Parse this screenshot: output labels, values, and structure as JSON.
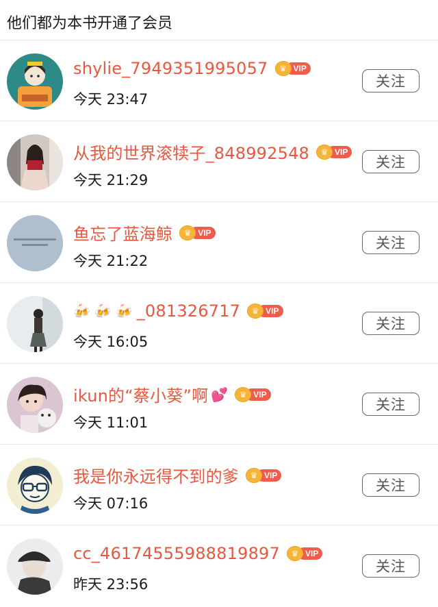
{
  "header": {
    "title": "他们都为本书开通了会员"
  },
  "vip_label": "VIP",
  "follow_label": "关注",
  "members": [
    {
      "name": "shylie_7949351995057",
      "time": "今天 23:47"
    },
    {
      "name": "从我的世界滚犊子_848992548",
      "time": "今天 21:29"
    },
    {
      "name": "鱼忘了蓝海鲸",
      "time": "今天 21:22"
    },
    {
      "name_prefix_icons": [
        "beer-mug-icon",
        "beer-mug-icon",
        "beer-mug-icon"
      ],
      "name": "_081326717",
      "time": "今天 16:05"
    },
    {
      "name": "ikun的“蔡小葵”啊",
      "name_suffix_icon": "sparkling-heart-icon",
      "time": "今天 11:01"
    },
    {
      "name": "我是你永远得不到的爹",
      "time": "今天 07:16"
    },
    {
      "name": "cc_46174555988819897",
      "time": "昨天 23:56"
    }
  ],
  "colors": {
    "name": "#e9573f",
    "vip_tag": "#ef5b4c",
    "vip_crown": "#f6b53a"
  }
}
